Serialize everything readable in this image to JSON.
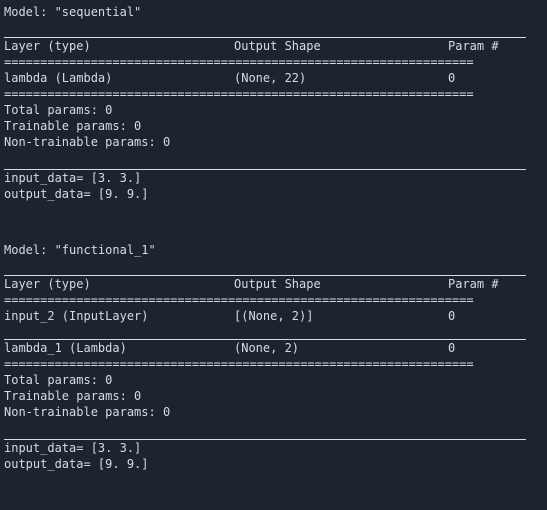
{
  "terminal": {
    "background_color": "#1d2430",
    "text_color": "#d6dbe4",
    "separator_char_line": "================================================================="
  },
  "blocks": [
    {
      "model_title": "Model: \"sequential\"",
      "table": {
        "headers": {
          "layer": "Layer (type)",
          "shape": "Output Shape",
          "param": "Param #"
        },
        "rows": [
          {
            "layer": "lambda (Lambda)",
            "shape": "(None, 22)",
            "param": "0"
          }
        ]
      },
      "params": {
        "total": "Total params: 0",
        "trainable": "Trainable params: 0",
        "non_trainable": "Non-trainable params: 0"
      },
      "output": {
        "input_data": "input_data= [3. 3.]",
        "output_data": "output_data= [9. 9.]"
      }
    },
    {
      "model_title": "Model: \"functional_1\"",
      "table": {
        "headers": {
          "layer": "Layer (type)",
          "shape": "Output Shape",
          "param": "Param #"
        },
        "rows": [
          {
            "layer": "input_2 (InputLayer)",
            "shape": "[(None, 2)]",
            "param": "0"
          },
          {
            "layer": "lambda_1 (Lambda)",
            "shape": "(None, 2)",
            "param": "0"
          }
        ]
      },
      "params": {
        "total": "Total params: 0",
        "trainable": "Trainable params: 0",
        "non_trainable": "Non-trainable params: 0"
      },
      "output": {
        "input_data": "input_data= [3. 3.]",
        "output_data": "output_data= [9. 9.]"
      }
    }
  ]
}
